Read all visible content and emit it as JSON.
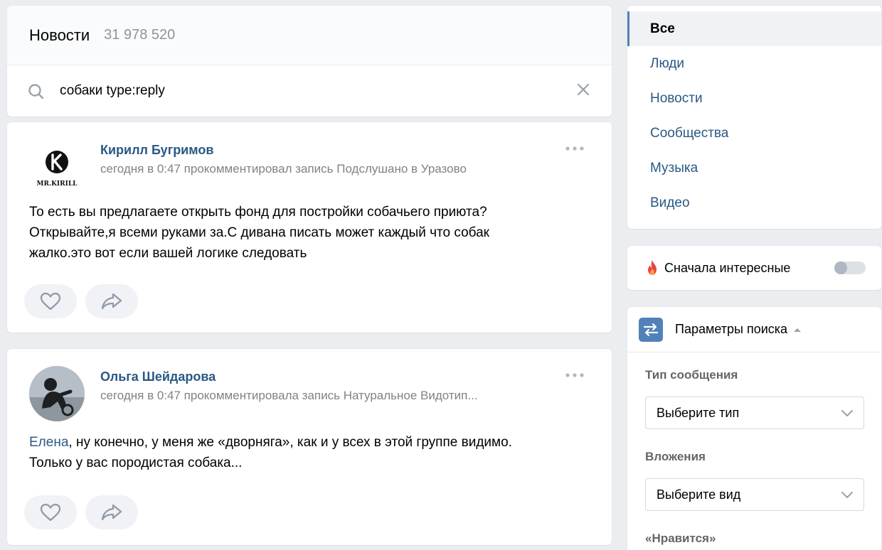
{
  "header": {
    "title": "Новости",
    "count": "31 978 520"
  },
  "search": {
    "query": "собаки type:reply"
  },
  "posts": [
    {
      "author": "Кирилл Бугримов",
      "meta_prefix": "сегодня в 0:47 прокомментировал запись ",
      "meta_link": "Подслушано в Уразово",
      "avatar_logo_text": "MR.KIRILL",
      "text_lines": [
        "То есть вы предлагаете открыть фонд для постройки собачьего приюта?",
        "Открывайте,я всеми руками за.С дивана писать может каждый что собак",
        "жалко.это вот если вашей логике следовать"
      ]
    },
    {
      "author": "Ольга Шейдарова",
      "meta_prefix": "сегодня в 0:47 прокомментировала запись ",
      "meta_link": "Натуральное Видотип...",
      "mention": "Елена",
      "text_line1_rest": ", ну конечно, у меня же «дворняга», как и у всех в этой группе видимо.",
      "text_line2": "Только у вас породистая собака..."
    }
  ],
  "filters": {
    "items": [
      "Все",
      "Люди",
      "Новости",
      "Сообщества",
      "Музыка",
      "Видео"
    ],
    "active": "Все"
  },
  "interesting": {
    "label": "Сначала интересные",
    "enabled": false
  },
  "params": {
    "title": "Параметры поиска",
    "message_type_label": "Тип сообщения",
    "message_type_value": "Выберите тип",
    "attachments_label": "Вложения",
    "attachments_value": "Выберите вид",
    "likes_label": "«Нравится»"
  },
  "colors": {
    "accent": "#5181b8",
    "link": "#2a5885",
    "muted": "#828282",
    "background": "#ebedf0"
  }
}
